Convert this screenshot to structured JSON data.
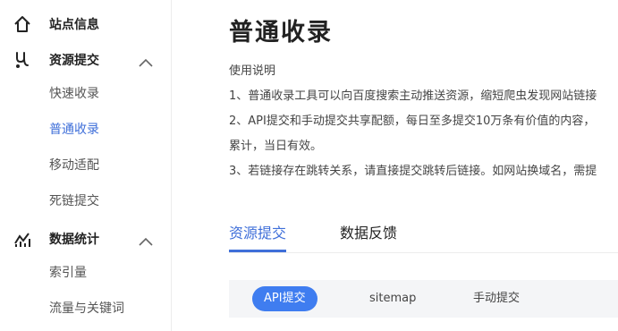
{
  "sidebar": {
    "groups": [
      {
        "label": "站点信息",
        "icon": "home-icon"
      },
      {
        "label": "资源提交",
        "icon": "submit-icon",
        "expanded": true,
        "items": [
          "快速收录",
          "普通收录",
          "移动适配",
          "死链提交"
        ]
      },
      {
        "label": "数据统计",
        "icon": "stats-icon",
        "expanded": true,
        "items": [
          "索引量",
          "流量与关键词"
        ]
      }
    ],
    "active_item": "普通收录"
  },
  "main": {
    "title": "普通收录",
    "usage_heading": "使用说明",
    "notes": [
      "1、普通收录工具可以向百度搜索主动推送资源，缩短爬虫发现网站链接",
      "2、API提交和手动提交共享配额，每日至多提交10万条有价值的内容，",
      "累计，当日有效。",
      "3、若链接存在跳转关系，请直接提交跳转后链接。如网站换域名，需提"
    ],
    "tabs": [
      "资源提交",
      "数据反馈"
    ],
    "active_tab": "资源提交",
    "methods": [
      "API提交",
      "sitemap",
      "手动提交"
    ],
    "active_method": "API提交"
  },
  "colors": {
    "accent": "#3f6fd9",
    "pill": "#3f7df0"
  }
}
